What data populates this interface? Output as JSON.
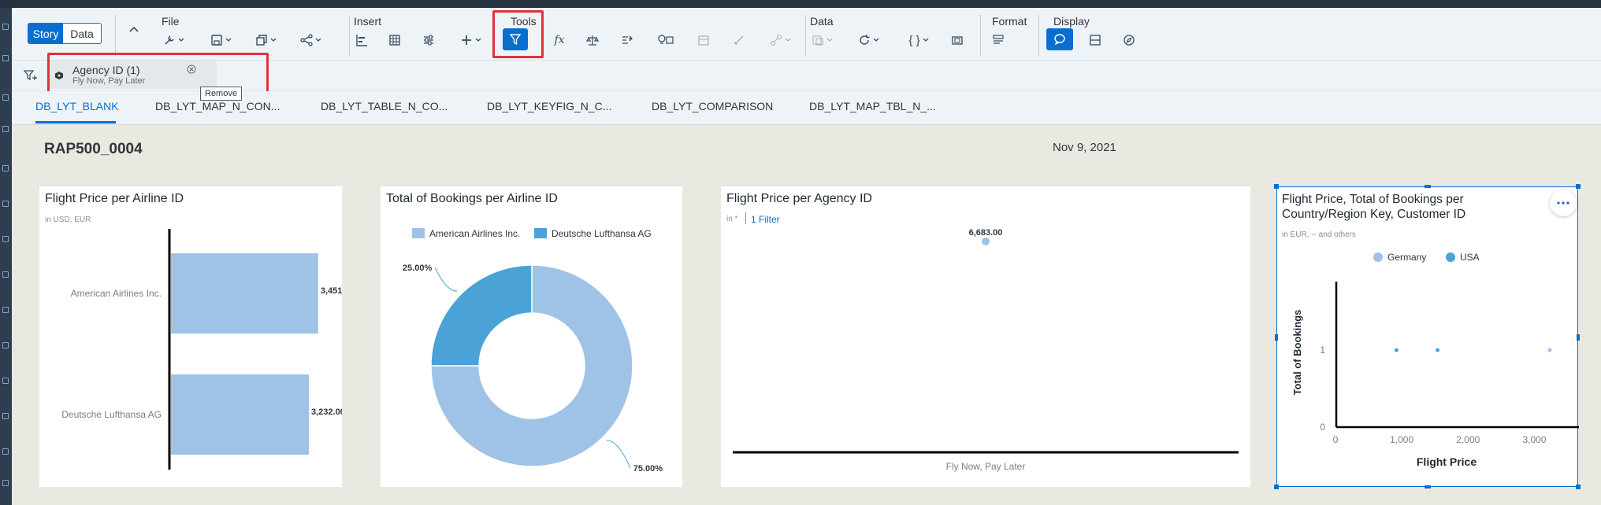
{
  "toolbar": {
    "story_label": "Story",
    "data_label": "Data",
    "groups": {
      "file": "File",
      "insert": "Insert",
      "tools": "Tools",
      "data": "Data",
      "format": "Format",
      "display": "Display"
    },
    "tools_icons": [
      "chart-builder-icon",
      "table-icon",
      "input-control-icon",
      "add-icon",
      "filter-icon",
      "formula-icon",
      "balance-icon",
      "linked-analysis-icon",
      "smart-insights-icon",
      "calendar-icon",
      "pen-icon",
      "link-icon",
      "data-change-icon",
      "refresh-icon",
      "braces-icon",
      "frame-icon",
      "view-icon",
      "comment-icon",
      "panel-icon",
      "explore-icon"
    ]
  },
  "filter_bar": {
    "token_title": "Agency ID (1)",
    "token_value": "Fly Now, Pay Later",
    "tooltip": "Remove"
  },
  "tabs": [
    "DB_LYT_BLANK",
    "DB_LYT_MAP_N_CON...",
    "DB_LYT_TABLE_N_CO...",
    "DB_LYT_KEYFIG_N_C...",
    "DB_LYT_COMPARISON",
    "DB_LYT_MAP_TBL_N_..."
  ],
  "active_tab": 0,
  "page": {
    "title": "RAP500_0004",
    "date": "Nov 9, 2021"
  },
  "colors": {
    "accent": "#0a6ed1",
    "highlight": "#e0323c",
    "bar_light": "#9fc3e7",
    "bar_dark": "#4ba2d7"
  },
  "cards": {
    "flight_price_airline": {
      "title": "Flight Price per Airline ID",
      "subtitle": "in USD, EUR"
    },
    "bookings_airline": {
      "title": "Total of Bookings per Airline ID"
    },
    "flight_price_agency": {
      "title": "Flight Price per Agency ID",
      "subtitle_prefix": "in *",
      "filter_link": "1 Filter"
    },
    "price_bookings_country": {
      "title_line1": "Flight Price, Total of Bookings per",
      "title_line2": "Country/Region Key, Customer ID",
      "subtitle": "in EUR, -- and others",
      "more_icon": "more-icon"
    }
  },
  "chart_data": [
    {
      "type": "bar",
      "orientation": "horizontal",
      "title": "Flight Price per Airline ID",
      "categories": [
        "American Airlines Inc.",
        "Deutsche Lufthansa AG"
      ],
      "values": [
        3451,
        3232
      ],
      "value_labels": [
        "3,451.00",
        "3,232.00"
      ],
      "xlim": [
        0,
        4200
      ]
    },
    {
      "type": "pie",
      "donut": true,
      "title": "Total of Bookings per Airline ID",
      "labels": [
        "American Airlines Inc.",
        "Deutsche Lufthansa AG"
      ],
      "values": [
        75,
        25
      ],
      "value_labels": [
        "75.00%",
        "25.00%"
      ],
      "colors": [
        "#9fc3e7",
        "#4ba2d7"
      ],
      "legend": "top"
    },
    {
      "type": "scatter",
      "title": "Flight Price per Agency ID",
      "categories": [
        "Fly Now, Pay Later"
      ],
      "values": [
        6683
      ],
      "value_labels": [
        "6,683.00"
      ],
      "ylim": [
        0,
        7500
      ]
    },
    {
      "type": "scatter",
      "title": "Flight Price, Total of Bookings per Country/Region Key, Customer ID",
      "xlabel": "Flight Price",
      "ylabel": "Total of Bookings",
      "x_ticks": [
        "0",
        "1,000",
        "2,000",
        "3,000"
      ],
      "y_ticks": [
        "0",
        "1"
      ],
      "xlim": [
        0,
        3850
      ],
      "ylim": [
        0,
        1.6
      ],
      "legend": "top",
      "series": [
        {
          "name": "Germany",
          "color": "#9fc3e7",
          "points": [
            [
              3232,
              1
            ]
          ]
        },
        {
          "name": "USA",
          "color": "#4ba2d7",
          "points": [
            [
              920,
              1
            ],
            [
              1540,
              1
            ]
          ]
        }
      ]
    }
  ]
}
